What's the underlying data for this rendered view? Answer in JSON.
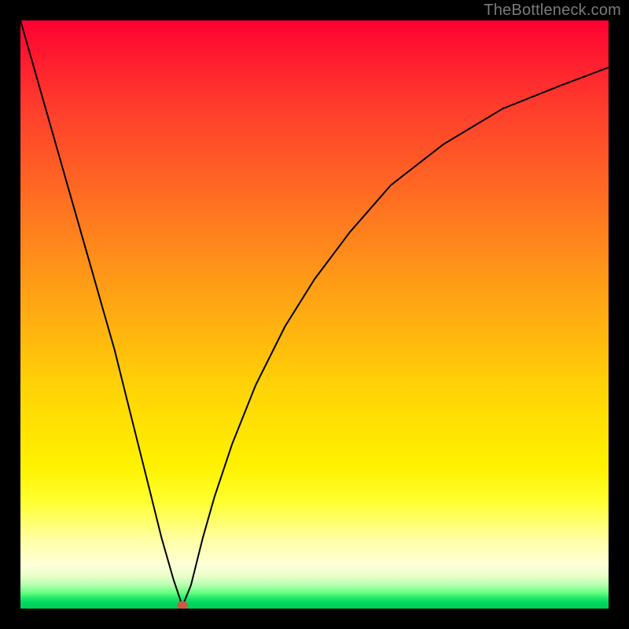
{
  "watermark": "TheBottleneck.com",
  "chart_data": {
    "type": "line",
    "title": "",
    "xlabel": "",
    "ylabel": "",
    "xlim": [
      0,
      100
    ],
    "ylim": [
      0,
      100
    ],
    "grid": false,
    "background_gradient": {
      "direction": "top-to-bottom",
      "stops": [
        {
          "pct": 0,
          "color": "#ff0033"
        },
        {
          "pct": 24,
          "color": "#ff5a26"
        },
        {
          "pct": 54,
          "color": "#ffb80e"
        },
        {
          "pct": 76,
          "color": "#fff200"
        },
        {
          "pct": 92,
          "color": "#ffffd8"
        },
        {
          "pct": 97,
          "color": "#66ff80"
        },
        {
          "pct": 100,
          "color": "#00cc55"
        }
      ]
    },
    "series": [
      {
        "name": "bottleneck-curve",
        "color": "#000000",
        "x": [
          0,
          2,
          4,
          6,
          8,
          10,
          12,
          14,
          16,
          18,
          20,
          22,
          24,
          26,
          27,
          27.5,
          28,
          29,
          30,
          31,
          33,
          36,
          40,
          45,
          50,
          56,
          63,
          72,
          82,
          92,
          100
        ],
        "y": [
          100,
          93,
          86,
          79,
          72,
          65,
          58,
          51,
          44,
          36,
          28,
          20,
          12,
          5,
          2,
          0.5,
          1.5,
          4,
          8,
          12,
          19,
          28,
          38,
          48,
          56,
          64,
          72,
          79,
          85,
          89,
          92
        ]
      }
    ],
    "marker": {
      "name": "optimal-point",
      "x": 27.5,
      "y": 0.5,
      "color": "#c95b44"
    }
  }
}
